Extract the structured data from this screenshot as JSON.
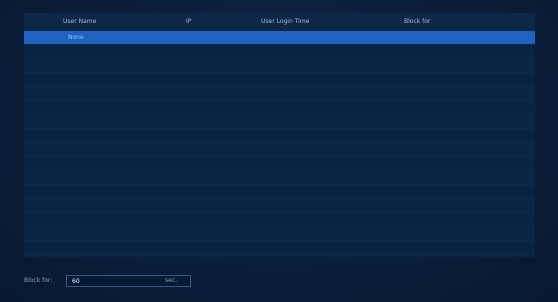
{
  "table": {
    "columns": [
      "User Name",
      "IP",
      "User Login Time",
      "Block for"
    ],
    "rows": [
      {
        "user_name": "None",
        "ip": "",
        "login_time": "",
        "block_for": ""
      }
    ]
  },
  "footer": {
    "label": "Block for:",
    "value": "60",
    "unit": "sec."
  },
  "colors": {
    "background": "#0a1e38",
    "selected_row": "#1f62c0",
    "selected_text": "#7fd0ff"
  }
}
